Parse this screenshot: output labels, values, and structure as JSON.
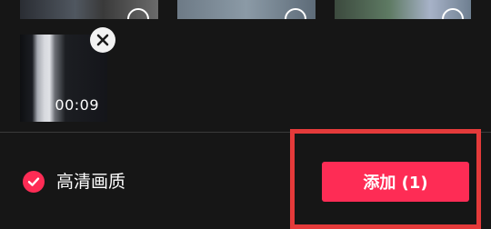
{
  "media_grid": {
    "thumbnails": [
      {
        "icon": "selection-circle-icon"
      },
      {
        "icon": "selection-circle-icon"
      },
      {
        "icon": "selection-circle-icon"
      }
    ]
  },
  "selected_tray": {
    "clips": [
      {
        "duration": "00:09",
        "remove_icon": "close-icon"
      }
    ]
  },
  "footer": {
    "hq_label": "高清画质",
    "hq_checked": true,
    "add_button_label": "添加 (1)"
  },
  "colors": {
    "accent": "#fe2c55",
    "highlight_box": "#e43a3a",
    "background": "#161616"
  }
}
